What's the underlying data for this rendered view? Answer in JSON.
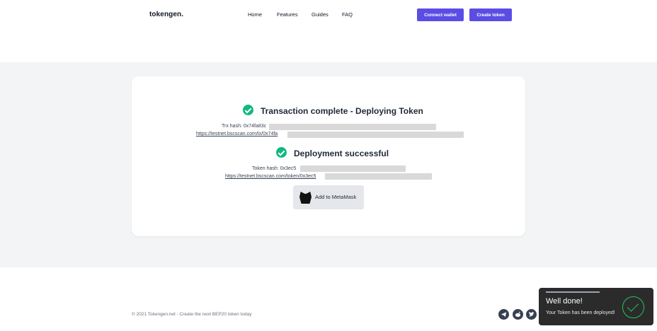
{
  "nav": {
    "logo": "tokengen.",
    "links": [
      "Home",
      "Features",
      "Guides",
      "FAQ"
    ],
    "connect_wallet": "Connect wallet",
    "create_token": "Create token"
  },
  "status": {
    "transaction": {
      "heading": "Transaction complete - Deploying Token",
      "hash_label": "Trx hash: 0x74fa83c",
      "link_text": "https://testnet.bscscan.com/tx/0x74fa"
    },
    "deployment": {
      "heading": "Deployment successful",
      "hash_label": "Token hash: 0x3ec5",
      "link_text": "https://testnet.bscscan.com/token/0x3ec5"
    },
    "metamask_button": "Add to MetaMask"
  },
  "footer": {
    "text": "© 2021 Tokengen.net - Create the next BEP20 token today",
    "social_icons": [
      "telegram-icon",
      "reddit-icon",
      "twitter-icon"
    ]
  },
  "toast": {
    "title": "Well done!",
    "message": "Your Token has been deployed!"
  },
  "colors": {
    "accent": "#5b4de4",
    "success": "#10b981",
    "toast_bg": "#2b2b2b"
  }
}
